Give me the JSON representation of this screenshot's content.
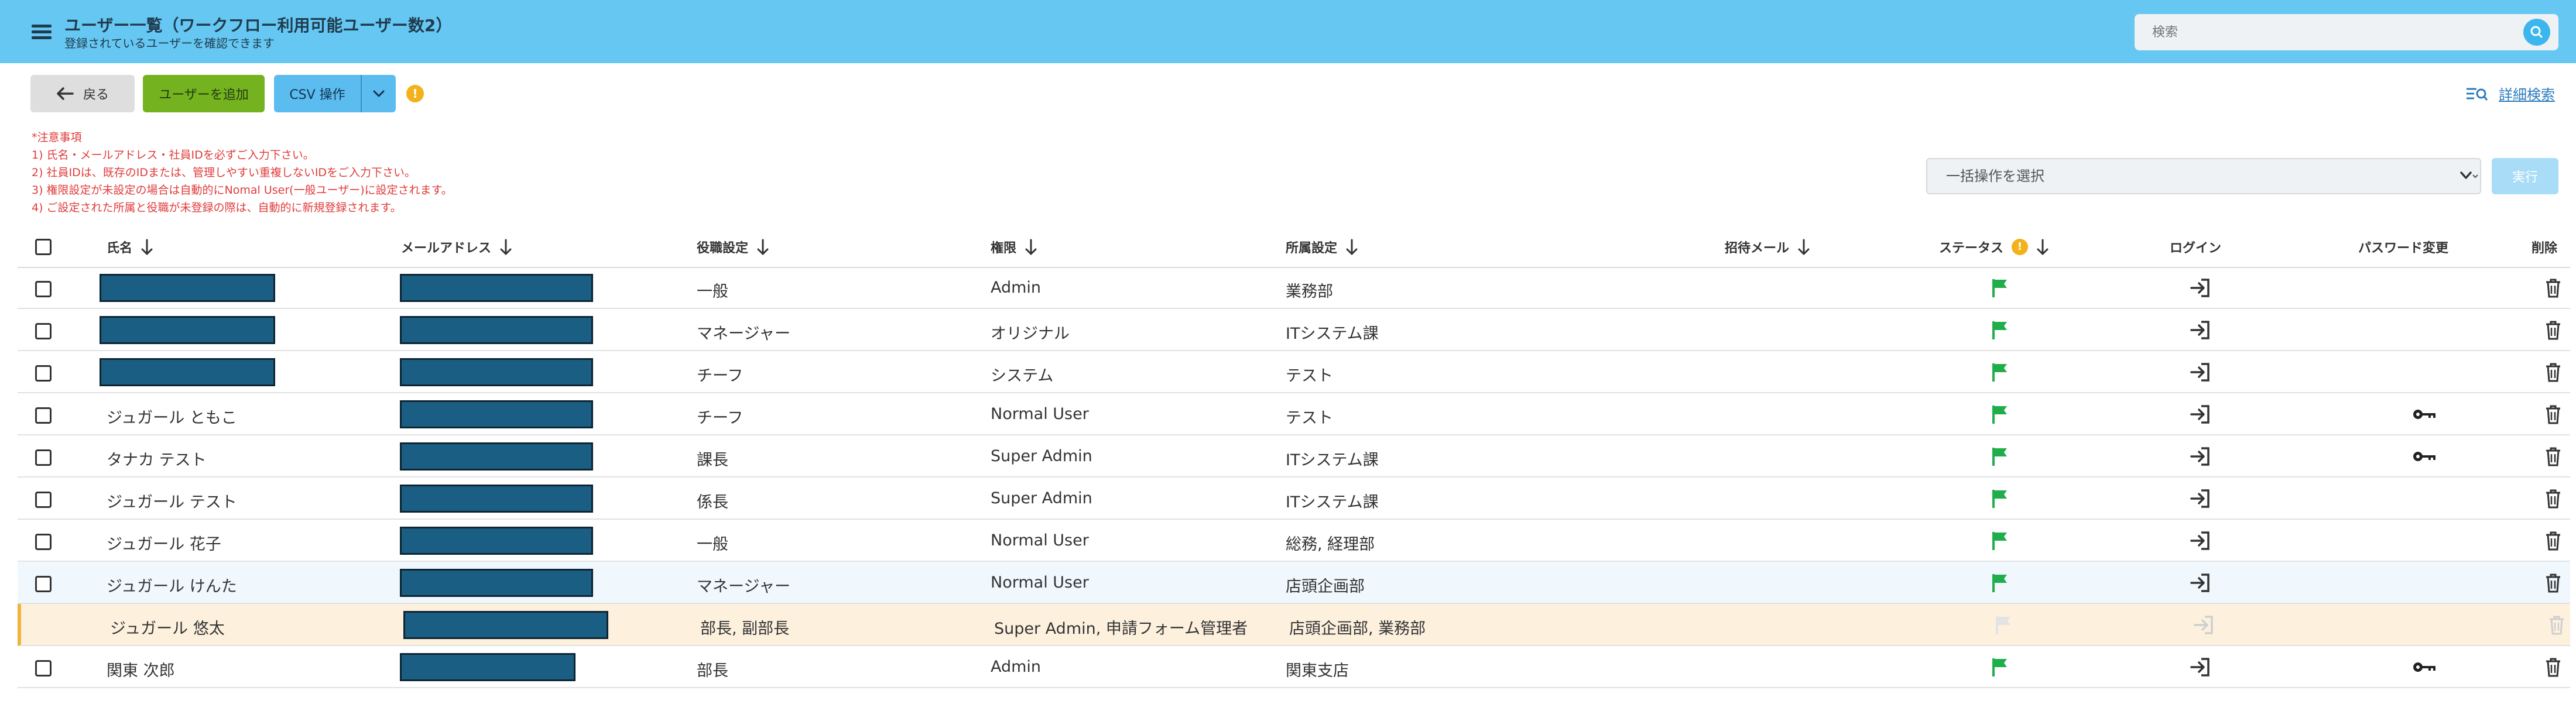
{
  "header": {
    "title": "ユーザー一覧（ワークフロー利用可能ユーザー数2）",
    "subtitle": "登録されているユーザーを確認できます",
    "search_placeholder": "検索"
  },
  "toolbar": {
    "back_label": "戻る",
    "add_user_label": "ユーザーを追加",
    "csv_label": "CSV 操作",
    "advanced_search_label": "詳細検索",
    "info_mark": "!"
  },
  "notes": [
    "*注意事項",
    "1) 氏名・メールアドレス・社員IDを必ずご入力下さい。",
    "2) 社員IDは、既存のIDまたは、管理しやすい重複しないIDをご入力下さい。",
    "3) 権限設定が未設定の場合は自動的にNomal User(一般ユーザー)に設定されます。",
    "4) ご設定された所属と役職が未登録の際は、自動的に新規登録されます。"
  ],
  "bulk": {
    "select_label": "一括操作を選択",
    "execute_label": "実行"
  },
  "table": {
    "columns": {
      "name": "氏名",
      "email": "メールアドレス",
      "position": "役職設定",
      "role": "権限",
      "department": "所属設定",
      "invite": "招待メール",
      "status": "ステータス",
      "login": "ログイン",
      "password": "パスワード変更",
      "delete": "削除"
    },
    "rows": [
      {
        "name": "",
        "position": "一般",
        "role": "Admin",
        "department": "業務部",
        "name_redacted": true,
        "password_key": false,
        "state": "normal",
        "status_color": "#1fae4a"
      },
      {
        "name": "",
        "position": "マネージャー",
        "role": "オリジナル",
        "department": "ITシステム課",
        "name_redacted": true,
        "password_key": false,
        "state": "normal",
        "status_color": "#1fae4a"
      },
      {
        "name": "",
        "position": "チーフ",
        "role": "システム",
        "department": "テスト",
        "name_redacted": true,
        "password_key": false,
        "state": "normal",
        "status_color": "#1fae4a"
      },
      {
        "name": "ジュガール ともこ",
        "position": "チーフ",
        "role": "Normal User",
        "department": "テスト",
        "name_redacted": false,
        "password_key": true,
        "state": "normal",
        "status_color": "#1fae4a"
      },
      {
        "name": "タナカ テスト",
        "position": "課長",
        "role": "Super Admin",
        "department": "ITシステム課",
        "name_redacted": false,
        "password_key": true,
        "state": "normal",
        "status_color": "#1fae4a"
      },
      {
        "name": "ジュガール テスト",
        "position": "係長",
        "role": "Super Admin",
        "department": "ITシステム課",
        "name_redacted": false,
        "password_key": false,
        "state": "normal",
        "status_color": "#1fae4a"
      },
      {
        "name": "ジュガール 花子",
        "position": "一般",
        "role": "Normal User",
        "department": "総務, 経理部",
        "name_redacted": false,
        "password_key": false,
        "state": "normal",
        "status_color": "#1fae4a"
      },
      {
        "name": "ジュガール けんた",
        "position": "マネージャー",
        "role": "Normal User",
        "department": "店頭企画部",
        "name_redacted": false,
        "password_key": false,
        "state": "hover",
        "status_color": "#1fae4a"
      },
      {
        "name": "ジュガール 悠太",
        "position": "部長, 副部長",
        "role": "Super Admin, 申請フォーム管理者",
        "department": "店頭企画部, 業務部",
        "name_redacted": false,
        "password_key": false,
        "state": "disabled",
        "status_color": "#e3e3e3"
      },
      {
        "name": "関東 次郎",
        "position": "部長",
        "role": "Admin",
        "department": "関東支店",
        "name_redacted": false,
        "password_key": true,
        "state": "normal",
        "status_color": "#1fae4a"
      }
    ]
  },
  "colors": {
    "header_bg": "#66c7f2",
    "add_button": "#75b21f",
    "csv_button": "#5bbcf0",
    "note_red": "#e03b3b",
    "status_active": "#1fae4a",
    "redaction": "#1b5e83",
    "disabled_row": "#fdf1de"
  },
  "icons": {
    "menu": "hamburger-icon",
    "search": "search-icon",
    "back": "arrow-left-icon",
    "caret": "chevron-down-icon",
    "advanced_search": "filter-search-icon",
    "sort": "arrow-down-icon",
    "status": "flag-icon",
    "login": "login-icon",
    "password": "key-icon",
    "delete": "trash-icon"
  }
}
